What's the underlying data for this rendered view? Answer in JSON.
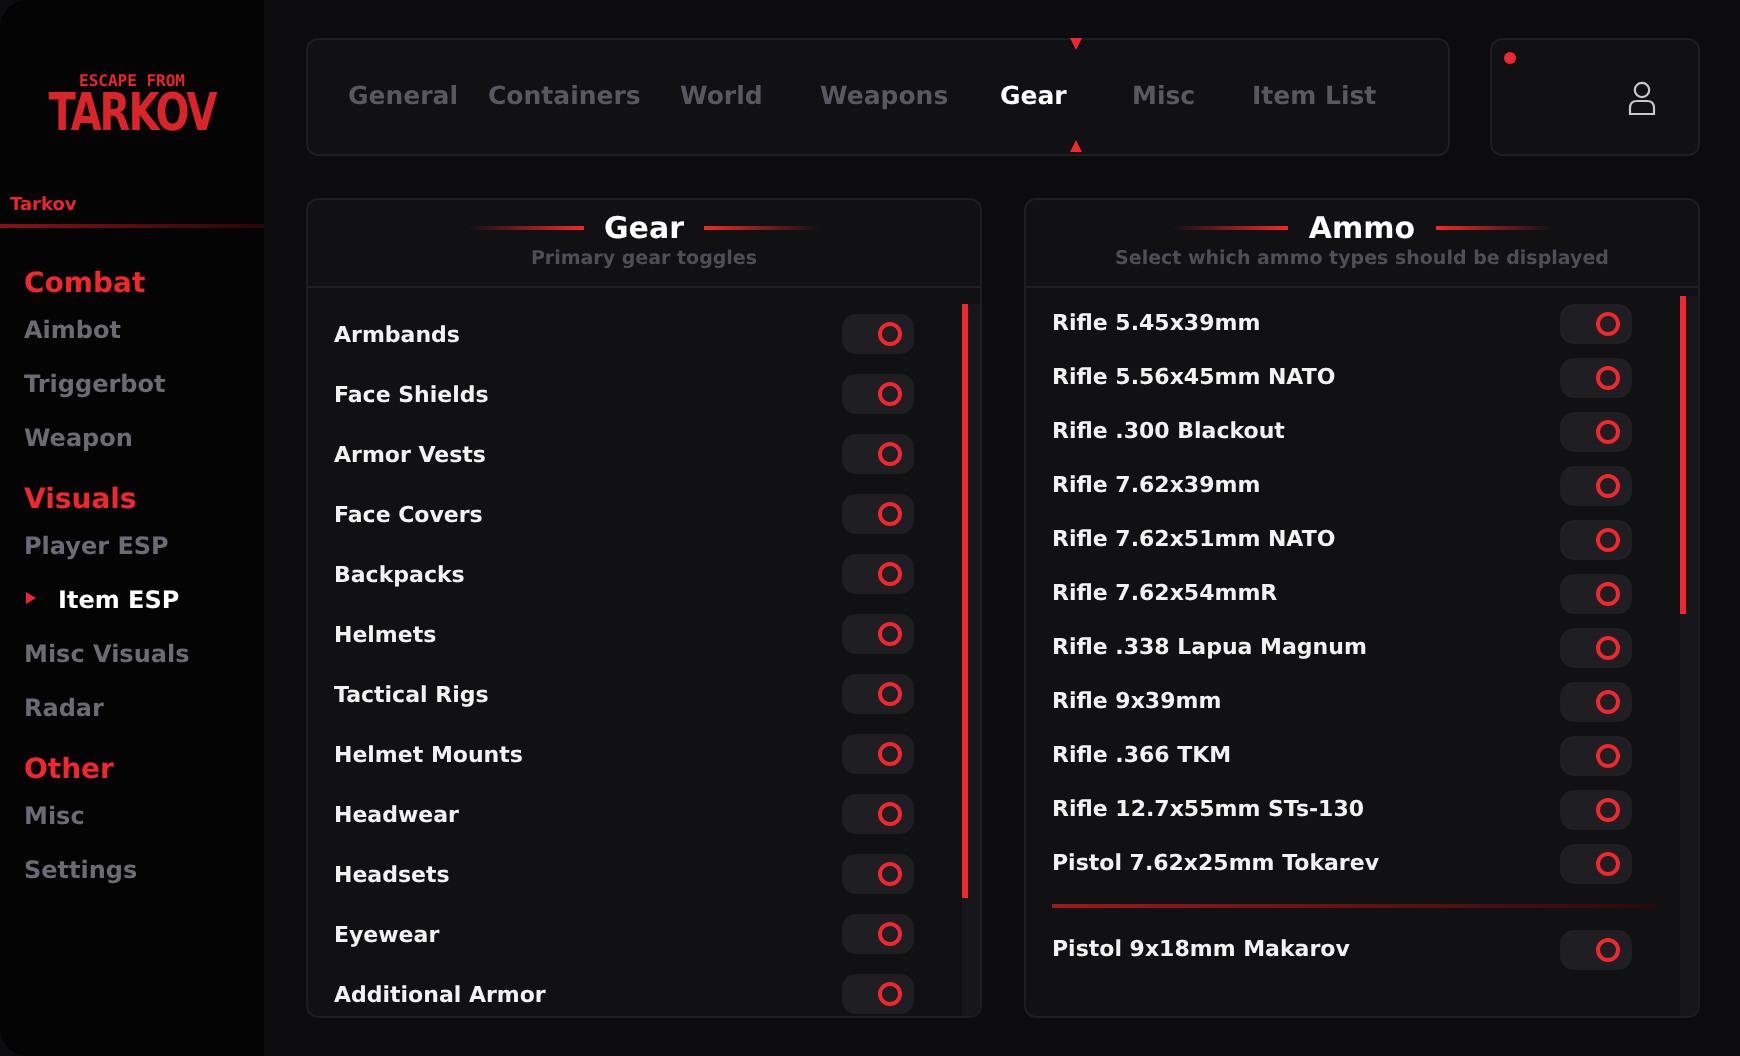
{
  "sidebar": {
    "logo": {
      "top": "ESCAPE FROM",
      "bottom": "TARKOV"
    },
    "brand": "Tarkov",
    "sections": [
      {
        "title": "Combat",
        "items": [
          {
            "label": "Aimbot",
            "selected": false
          },
          {
            "label": "Triggerbot",
            "selected": false
          },
          {
            "label": "Weapon",
            "selected": false
          }
        ]
      },
      {
        "title": "Visuals",
        "items": [
          {
            "label": "Player ESP",
            "selected": false
          },
          {
            "label": "Item ESP",
            "selected": true
          },
          {
            "label": "Misc Visuals",
            "selected": false
          },
          {
            "label": "Radar",
            "selected": false
          }
        ]
      },
      {
        "title": "Other",
        "items": [
          {
            "label": "Misc",
            "selected": false
          },
          {
            "label": "Settings",
            "selected": false
          }
        ]
      }
    ]
  },
  "tabs": [
    {
      "label": "General",
      "selected": false
    },
    {
      "label": "Containers",
      "selected": false
    },
    {
      "label": "World",
      "selected": false
    },
    {
      "label": "Weapons",
      "selected": false
    },
    {
      "label": "Gear",
      "selected": true
    },
    {
      "label": "Misc",
      "selected": false
    },
    {
      "label": "Item List",
      "selected": false
    }
  ],
  "profile": {
    "online": true
  },
  "panels": [
    {
      "title": "Gear",
      "subtitle": "Primary gear toggles",
      "groups": [
        [
          {
            "label": "Armbands",
            "on": true
          },
          {
            "label": "Face Shields",
            "on": true
          },
          {
            "label": "Armor Vests",
            "on": true
          },
          {
            "label": "Face Covers",
            "on": true
          },
          {
            "label": "Backpacks",
            "on": true
          },
          {
            "label": "Helmets",
            "on": true
          },
          {
            "label": "Tactical Rigs",
            "on": true
          },
          {
            "label": "Helmet Mounts",
            "on": true
          },
          {
            "label": "Headwear",
            "on": true
          },
          {
            "label": "Headsets",
            "on": true
          },
          {
            "label": "Eyewear",
            "on": true
          },
          {
            "label": "Additional Armor",
            "on": true
          }
        ]
      ]
    },
    {
      "title": "Ammo",
      "subtitle": "Select which ammo types should be displayed",
      "groups": [
        [
          {
            "label": "Rifle 5.45x39mm",
            "on": true
          },
          {
            "label": "Rifle 5.56x45mm NATO",
            "on": true
          },
          {
            "label": "Rifle .300 Blackout",
            "on": true
          },
          {
            "label": "Rifle 7.62x39mm",
            "on": true
          },
          {
            "label": "Rifle 7.62x51mm NATO",
            "on": true
          },
          {
            "label": "Rifle 7.62x54mmR",
            "on": true
          },
          {
            "label": "Rifle .338 Lapua Magnum",
            "on": true
          },
          {
            "label": "Rifle 9x39mm",
            "on": true
          },
          {
            "label": "Rifle .366 TKM",
            "on": true
          },
          {
            "label": "Rifle 12.7x55mm STs-130",
            "on": true
          },
          {
            "label": "Pistol 7.62x25mm Tokarev",
            "on": true
          }
        ],
        [
          {
            "label": "Pistol 9x18mm Makarov",
            "on": true
          }
        ]
      ]
    }
  ]
}
